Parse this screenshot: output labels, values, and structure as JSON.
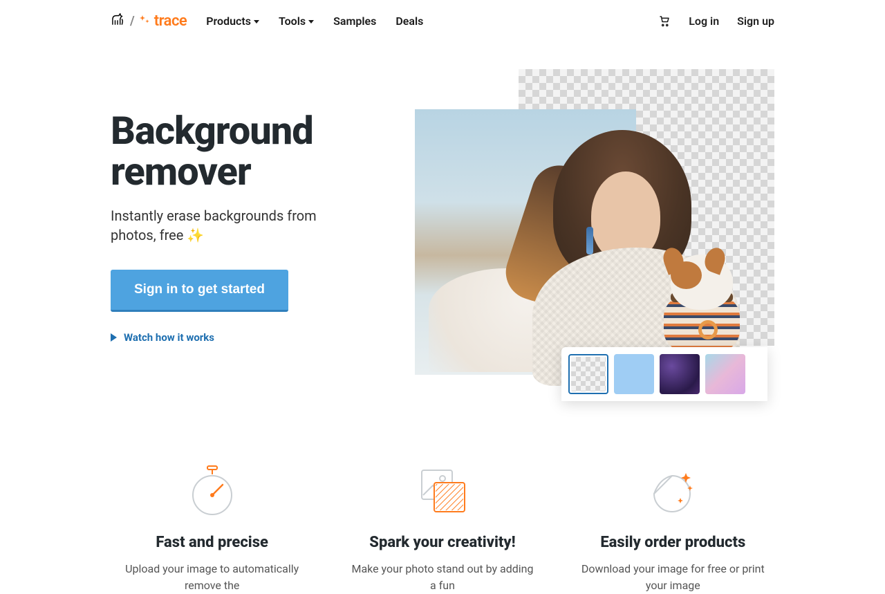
{
  "nav": {
    "products": "Products",
    "tools": "Tools",
    "samples": "Samples",
    "deals": "Deals",
    "login": "Log in",
    "signup": "Sign up"
  },
  "logo": {
    "word": "trace"
  },
  "hero": {
    "title_line1": "Background",
    "title_line2": "remover",
    "sub": "Instantly erase backgrounds from photos, free ",
    "sub_emoji": "✨",
    "cta": "Sign in to get started",
    "watch": "Watch how it works"
  },
  "bg_options": [
    {
      "name": "transparent"
    },
    {
      "name": "light-blue"
    },
    {
      "name": "galaxy"
    },
    {
      "name": "watercolor"
    }
  ],
  "features": [
    {
      "title": "Fast and precise",
      "desc": "Upload your image to automatically remove the"
    },
    {
      "title": "Spark your creativity!",
      "desc": "Make your photo stand out by adding a fun"
    },
    {
      "title": "Easily order products",
      "desc": "Download your image for free or print your image"
    }
  ]
}
